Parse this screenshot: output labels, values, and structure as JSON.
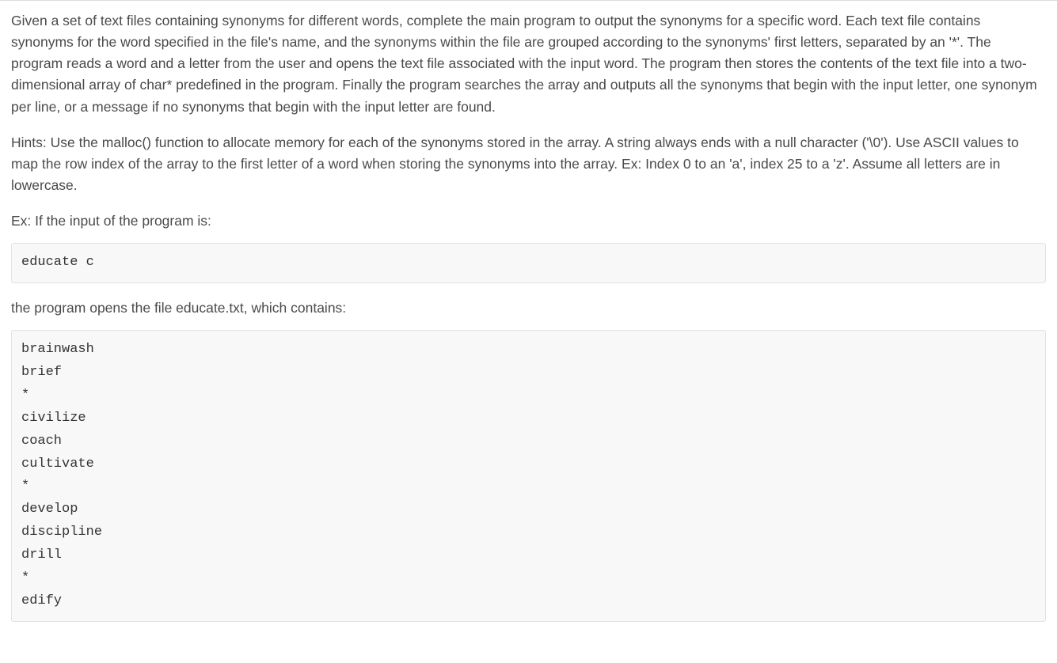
{
  "paragraphs": {
    "intro": "Given a set of text files containing synonyms for different words, complete the main program to output the synonyms for a specific word. Each text file contains synonyms for the word specified in the file's name, and the synonyms within the file are grouped according to the synonyms' first letters, separated by an '*'. The program reads a word and a letter from the user and opens the text file associated with the input word. The program then stores the contents of the text file into a two-dimensional array of char* predefined in the program. Finally the program searches the array and outputs all the synonyms that begin with the input letter, one synonym per line, or a message if no synonyms that begin with the input letter are found.",
    "hints": "Hints: Use the malloc() function to allocate memory for each of the synonyms stored in the array. A string always ends with a null character ('\\0'). Use ASCII values to map the row index of the array to the first letter of a word when storing the synonyms into the array. Ex: Index 0 to an 'a', index 25 to a 'z'. Assume all letters are in lowercase.",
    "example_prompt": "Ex: If the input of the program is:",
    "file_opens": "the program opens the file educate.txt, which contains:"
  },
  "code": {
    "input_example": "educate c",
    "file_contents": "brainwash\nbrief\n*\ncivilize\ncoach\ncultivate\n*\ndevelop\ndiscipline\ndrill\n*\nedify"
  }
}
